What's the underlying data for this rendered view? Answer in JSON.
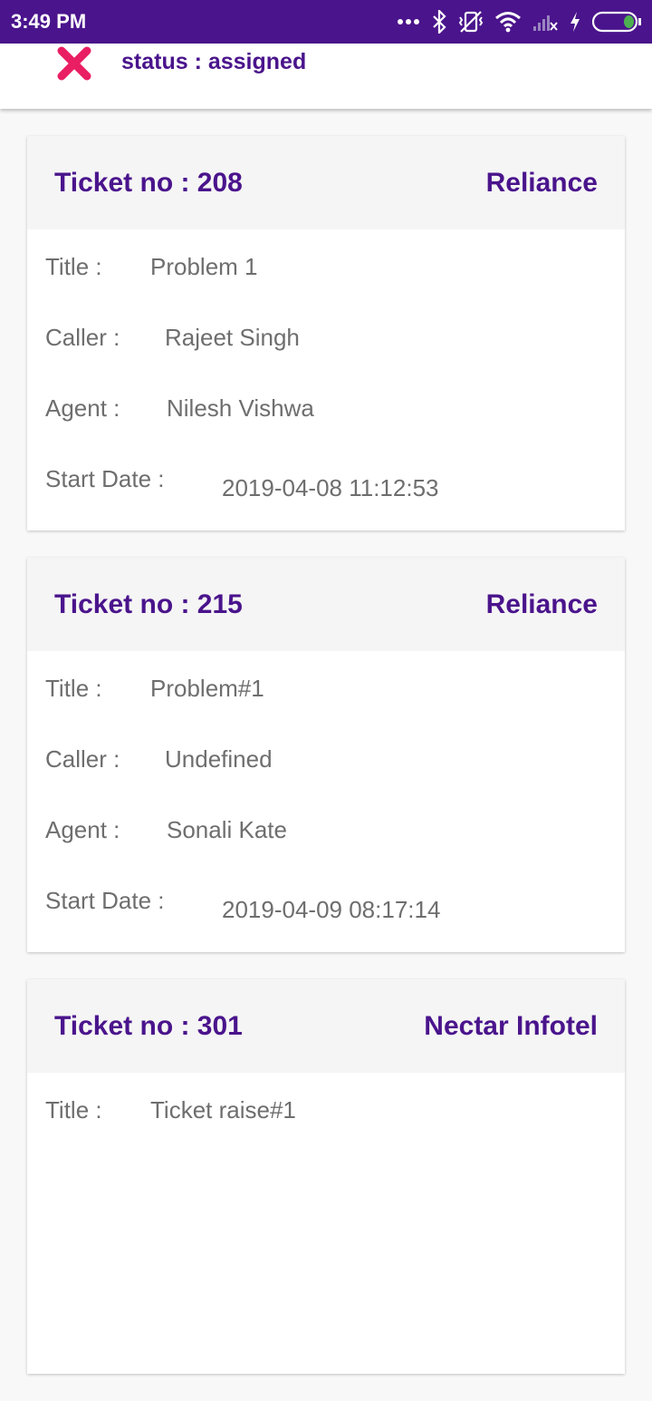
{
  "statusbar": {
    "time": "3:49 PM",
    "icons": [
      "dots-icon",
      "bluetooth-icon",
      "vibrate-off-icon",
      "wifi-icon",
      "signal-icon",
      "charging-icon",
      "battery-icon"
    ]
  },
  "header": {
    "status_text": "status : assigned",
    "close_icon_color": "#e91e63"
  },
  "colors": {
    "primary": "#4a148c",
    "text": "#6e6e6e"
  },
  "labels": {
    "title": "Title :",
    "caller": "Caller :",
    "agent": "Agent :",
    "start_date": "Start Date :"
  },
  "tickets": [
    {
      "ticket_no": "Ticket no : 208",
      "company": "Reliance",
      "title": "Problem 1",
      "caller": "Rajeet Singh",
      "agent": "Nilesh Vishwa",
      "start_date": "2019-04-08 11:12:53"
    },
    {
      "ticket_no": "Ticket no : 215",
      "company": "Reliance",
      "title": "Problem#1",
      "caller": "Undefined",
      "agent": "Sonali Kate",
      "start_date": "2019-04-09 08:17:14"
    },
    {
      "ticket_no": "Ticket no : 301",
      "company": "Nectar Infotel",
      "title": "Ticket raise#1"
    }
  ]
}
